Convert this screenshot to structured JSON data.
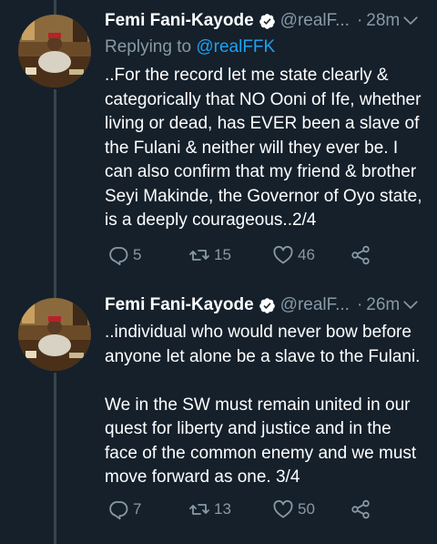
{
  "tweets": [
    {
      "author_name": "Femi Fani-Kayode",
      "handle": "@realF...",
      "separator": "·",
      "time": "28m",
      "replying_prefix": "Replying to ",
      "replying_to": "@realFFK",
      "body": "..For the record let me state clearly & categorically that NO Ooni of Ife, whether living or dead, has EVER been a slave of the Fulani & neither will they ever be. I can also confirm that my friend & brother Seyi Makinde, the Governor of Oyo state, is a deeply courageous..2/4",
      "replies": "5",
      "retweets": "15",
      "likes": "46"
    },
    {
      "author_name": "Femi Fani-Kayode",
      "handle": "@realF...",
      "separator": "·",
      "time": "26m",
      "body": "..individual who would never bow before anyone let alone be a slave to the Fulani.\n\nWe in the SW must remain united in our quest for liberty and justice and in the face of the common enemy and we must move forward as one. 3/4",
      "replies": "7",
      "retweets": "13",
      "likes": "50"
    }
  ],
  "colors": {
    "background": "#15202b",
    "secondary_text": "#8899a6",
    "link": "#1da1f2",
    "thread_line": "#38444d"
  },
  "icons": [
    "verified-badge-icon",
    "caret-down-icon",
    "reply-icon",
    "retweet-icon",
    "like-icon",
    "share-icon"
  ]
}
